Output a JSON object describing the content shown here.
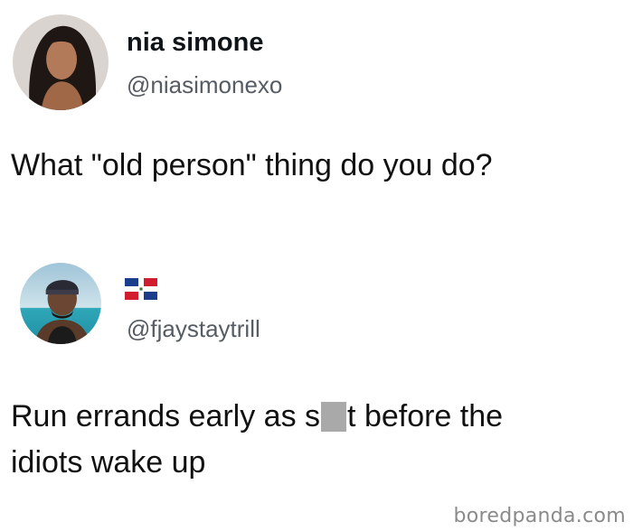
{
  "original_post": {
    "author_name": "nia simone",
    "author_handle": "@niasimonexo",
    "text": "What \"old person\" thing do you do?"
  },
  "reply_post": {
    "author_flag": "dominican-republic-flag",
    "author_handle": "@fjaystaytrill",
    "text_line1_before": "Run errands early as s",
    "text_line1_after": "t before the",
    "text_line2": "idiots wake up"
  },
  "watermark": "boredpanda.com",
  "colors": {
    "text": "#0f1419",
    "handle": "#555c63",
    "censor_box": "#a9a9a9",
    "watermark": "#8a8a8a",
    "background": "#ffffff"
  }
}
